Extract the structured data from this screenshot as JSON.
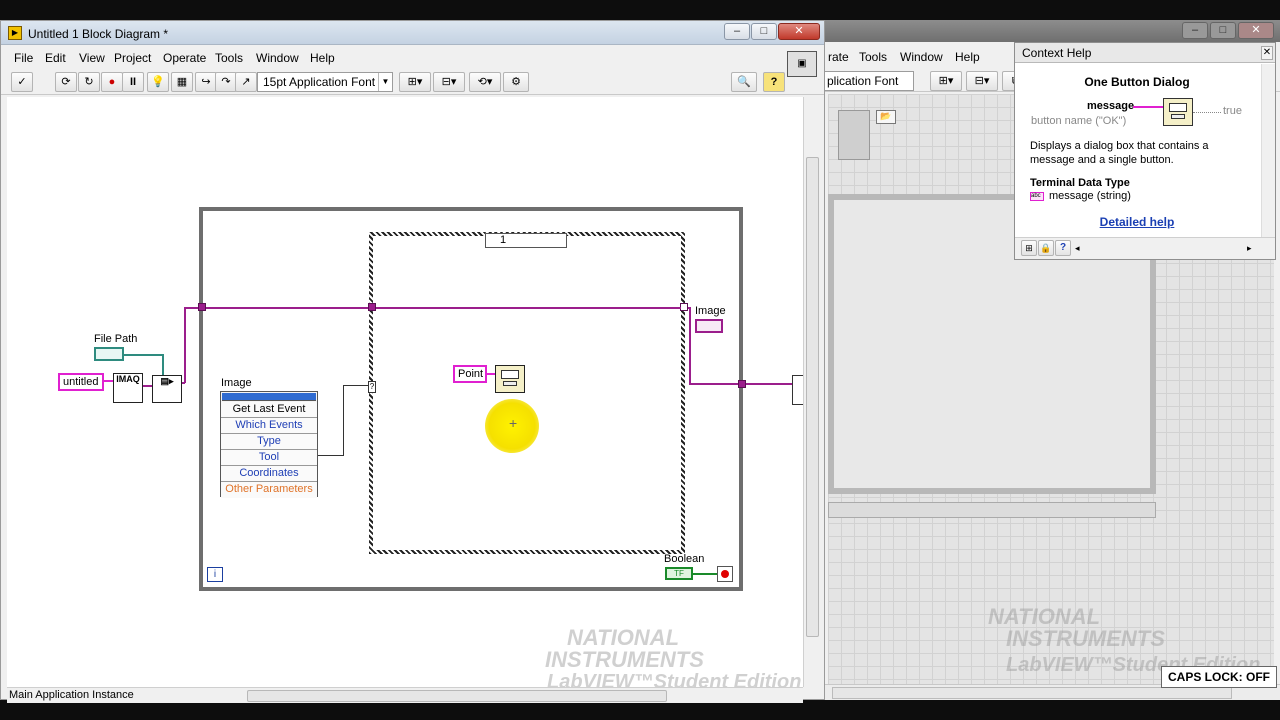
{
  "back_window": {
    "menu": [
      "rate",
      "Tools",
      "Window",
      "Help"
    ],
    "font_ring": "plication Font"
  },
  "main_window": {
    "title": "Untitled 1 Block Diagram *",
    "menu": [
      "File",
      "Edit",
      "View",
      "Project",
      "Operate",
      "Tools",
      "Window",
      "Help"
    ],
    "font_ring": "15pt Application Font",
    "status_instance": "Main Application Instance"
  },
  "diagram": {
    "file_path_label": "File Path",
    "untitled_const": "untitled",
    "imaq_label": "IMAQ",
    "event_node_label": "Image",
    "event_node_rows": [
      "Get Last Event",
      "Which Events",
      "Type",
      "Tool",
      "Coordinates",
      "Other Parameters"
    ],
    "event_case_value": "1",
    "point_const": "Point",
    "image_indicator_label": "Image",
    "boolean_label": "Boolean",
    "boolean_term_text": "TF",
    "iteration_symbol": "i",
    "watermark": {
      "line1": "NATIONAL",
      "line2": "INSTRUMENTS",
      "line3": "LabVIEW™Student Edition"
    }
  },
  "context_help": {
    "title": "Context Help",
    "heading": "One Button Dialog",
    "input_main": "message",
    "input_optional": "button name (\"OK\")",
    "output": "true",
    "description": "Displays a dialog box that contains a message and a single button.",
    "terminal_heading": "Terminal Data Type",
    "terminal_type": "message (string)",
    "link": "Detailed help"
  },
  "caps_lock": "CAPS LOCK: OFF",
  "colors": {
    "string_wire": "#e020d0",
    "image_wire": "#9b1e8c",
    "path_wire": "#2e8b7f",
    "boolean_wire": "#1a8a2a",
    "highlight": "#f5e000"
  }
}
